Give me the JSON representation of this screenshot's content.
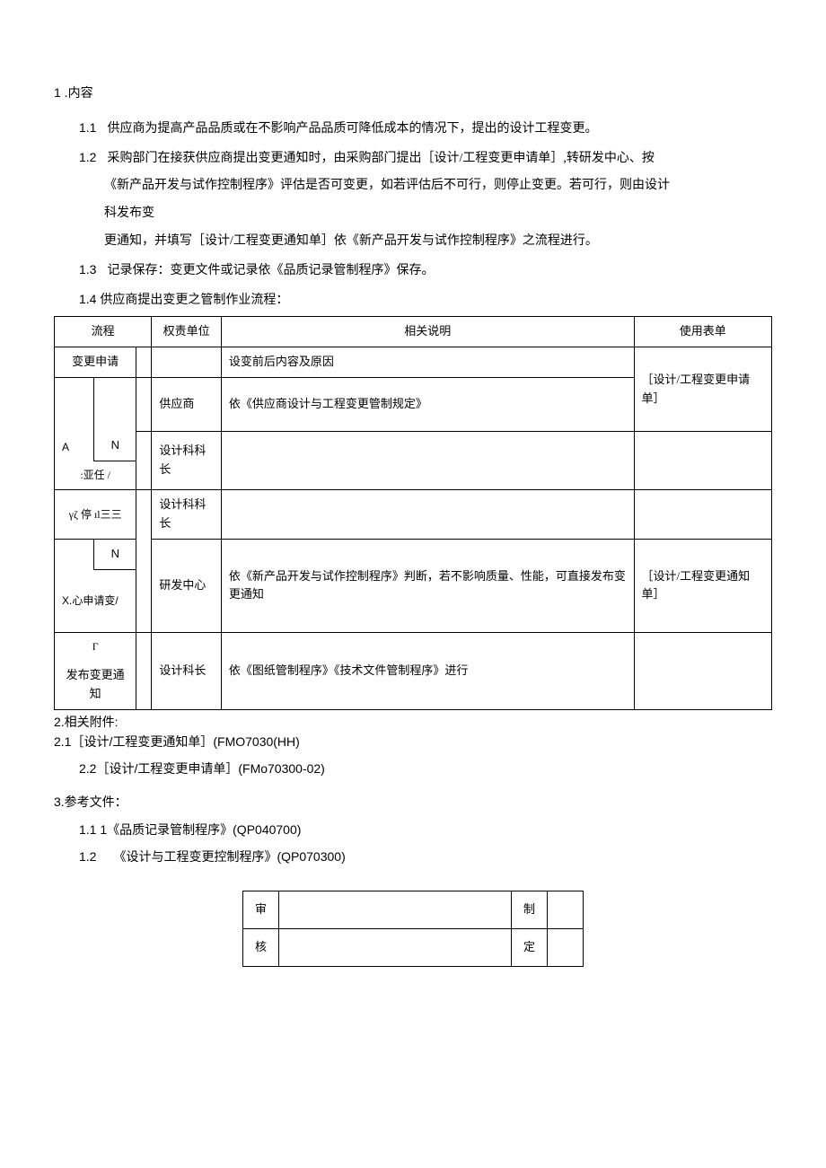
{
  "s1": {
    "title": "1 .内容",
    "p11_num": "1.1",
    "p11": "供应商为提高产品品质或在不影响产品品质可降低成本的情况下，提出的设计工程变更。",
    "p12_num": "1.2",
    "p12a": "采购部门在接获供应商提出变更通知时，由采购部门提出［设计/工程变更申请单］,转研发中心、按",
    "p12b": "《新产品开发与试作控制程序》评估是否可变更，如若评估后不可行，则停止变更。若可行，则由设计",
    "p12c": "科发布变",
    "p12d": "更通知，并填写［设计/工程变更通知单］依《新产品开发与试作控制程序》之流程进行。",
    "p13_num": "1.3",
    "p13": "记录保存：变更文件或记录依《品质记录管制程序》保存。",
    "p14": "1.4 供应商提出变更之管制作业流程："
  },
  "table": {
    "h1": "流程",
    "h2": "权责单位",
    "h3": "相关说明",
    "h4": "使用表单",
    "r1c1": "变更申请",
    "r1c3": "设变前后内容及原因",
    "r1c4_a": "［设计/工程变更申请",
    "r2c2": "供应商",
    "r2c3": "依《供应商设计与工程变更管制规定》",
    "r2c4": "单］",
    "r3a_n": "N",
    "r3b_left": ":亚任   /",
    "r3c2": "设计科科长",
    "r4a_left": "γζ          停 ıl三三",
    "r4c2": "设计科科长",
    "r5a_n": "N",
    "r5b_left": "X.心申请变/",
    "r5c2": "研发中心",
    "r5c3": "依《新产品开发与试作控制程序》判断，若不影响质量、性能，可直接发布变更通知",
    "r5c4": "［设计/工程变更通知单］",
    "r6a_left": "Γ",
    "r6b_left": "发布变更通知",
    "r6c2": "设计科长",
    "r6c3": "依《图纸管制程序》《技术文件管制程序》进行"
  },
  "s2": {
    "h": "2.相关附件:",
    "p21": "2.1［设计/工程变更通知单］(FMO7030(HH)",
    "p22": "2.2［设计/工程变更申请单］(FMo70300-02)"
  },
  "s3": {
    "h": "3.参考文件：",
    "p11": "1.1 1《品质记录管制程序》(QP040700)",
    "p12_num": "1.2",
    "p12": "《设计与工程变更控制程序》(QP070300)"
  },
  "sig": {
    "a1": "审",
    "a2": "核",
    "b1": "制",
    "b2": "定"
  }
}
